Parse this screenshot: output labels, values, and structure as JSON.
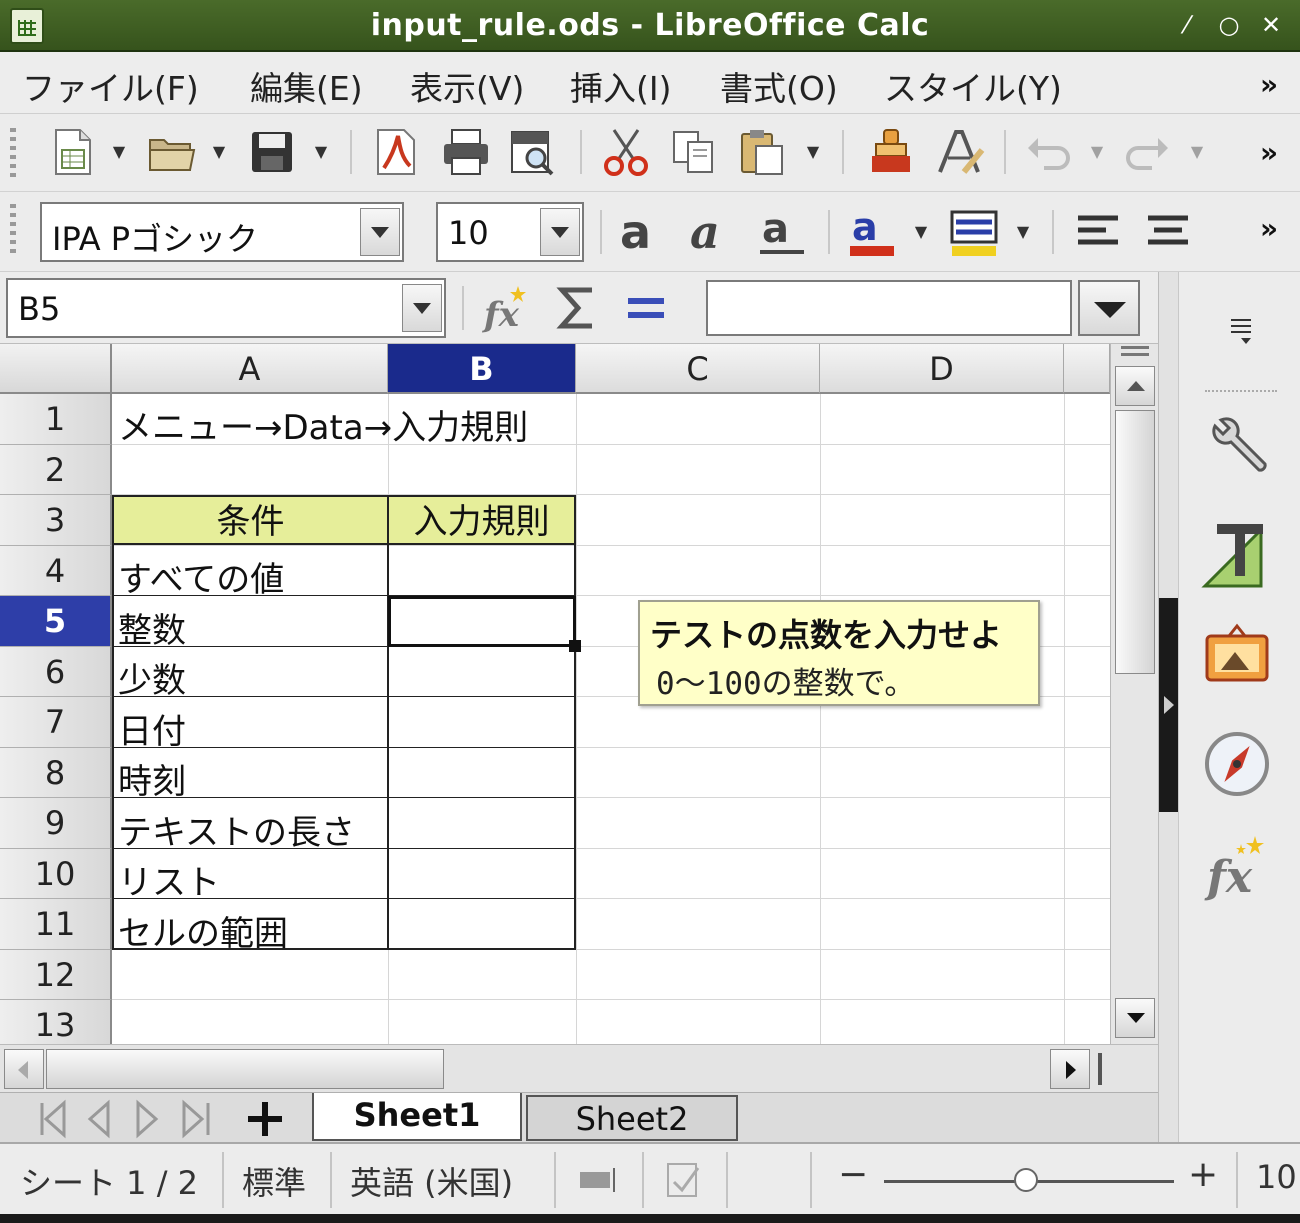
{
  "window": {
    "title": "input_rule.ods - LibreOffice Calc",
    "controls": [
      "⁄",
      "○",
      "✕"
    ]
  },
  "menu": [
    "ファイル(F)",
    "編集(E)",
    "表示(V)",
    "挿入(I)",
    "書式(O)",
    "スタイル(Y)"
  ],
  "overflow": "»",
  "format": {
    "font_name": "IPA Pゴシック",
    "font_size": "10"
  },
  "formula_bar": {
    "name_box": "B5",
    "input": "",
    "function_wizard_icon": "fx-icon",
    "sum_icon": "sigma-icon",
    "formula_icon": "equals-icon"
  },
  "grid": {
    "columns": [
      "A",
      "B",
      "C",
      "D"
    ],
    "selected_column": "B",
    "rows": [
      "1",
      "2",
      "3",
      "4",
      "5",
      "6",
      "7",
      "8",
      "9",
      "10",
      "11",
      "12",
      "13"
    ],
    "selected_row": "5",
    "a1": "メニュー→Data→入力規則",
    "a3": "条件",
    "b3": "入力規則",
    "conditions": [
      "すべての値",
      "整数",
      "少数",
      "日付",
      "時刻",
      "テキストの長さ",
      "リスト",
      "セルの範囲"
    ]
  },
  "tooltip": {
    "title": "テストの点数を入力せよ",
    "body": "0〜100の整数で。"
  },
  "tabs": {
    "active": "Sheet1",
    "other": "Sheet2",
    "add_icon": "plus-icon"
  },
  "status": {
    "sheet": "シート 1 / 2",
    "page_style": "標準",
    "language": "英語 (米国)",
    "zoom": "10"
  },
  "colors": {
    "header_fill": "#e6ee9a",
    "selection": "#1a2a8c",
    "titlebar": "#3f5f22",
    "tooltip_bg": "#ffffc8"
  }
}
